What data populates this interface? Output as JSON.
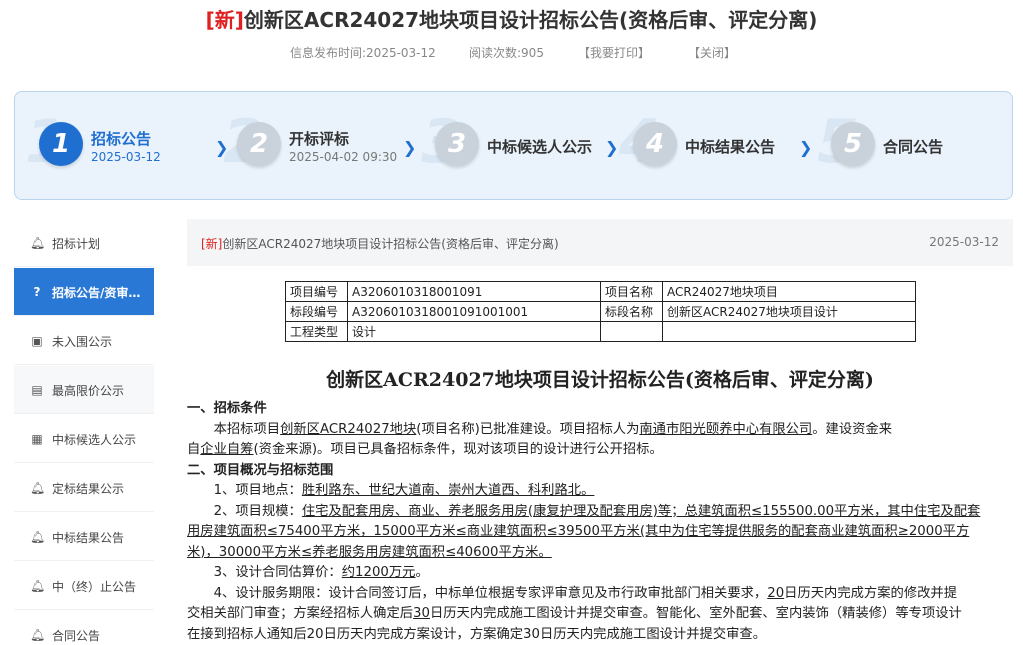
{
  "header": {
    "new_tag": "[新]",
    "title": "创新区ACR24027地块项目设计招标公告(资格后审、评定分离)",
    "publish_time": "信息发布时间:2025-03-12",
    "read_count": "阅读次数:905",
    "print_label": "【我要打印】",
    "close_label": "【关闭】"
  },
  "steps": [
    {
      "num": "1",
      "label": "招标公告",
      "date": "2025-03-12"
    },
    {
      "num": "2",
      "label": "开标评标",
      "date": "2025-04-02 09:30"
    },
    {
      "num": "3",
      "label": "中标候选人公示",
      "date": ""
    },
    {
      "num": "4",
      "label": "中标结果公告",
      "date": ""
    },
    {
      "num": "5",
      "label": "合同公告",
      "date": ""
    }
  ],
  "sidebar": {
    "items": [
      {
        "label": "招标计划",
        "icon": "bell-icon"
      },
      {
        "label": "招标公告/资审…",
        "icon": "question-icon"
      },
      {
        "label": "未入围公示",
        "icon": "briefcase-icon"
      },
      {
        "label": "最高限价公示",
        "icon": "price-tag-icon"
      },
      {
        "label": "中标候选人公示",
        "icon": "document-icon"
      },
      {
        "label": "定标结果公示",
        "icon": "bell-icon"
      },
      {
        "label": "中标结果公告",
        "icon": "bell-icon"
      },
      {
        "label": "中（终）止公告",
        "icon": "bell-icon"
      },
      {
        "label": "合同公告",
        "icon": "bell-icon"
      }
    ]
  },
  "crumb": {
    "new_tag": "[新]",
    "title": "创新区ACR24027地块项目设计招标公告(资格后审、评定分离)",
    "date": "2025-03-12"
  },
  "info_table": {
    "r1": [
      "项目编号",
      "A3206010318001091",
      "项目名称",
      "ACR24027地块项目"
    ],
    "r2": [
      "标段编号",
      "A3206010318001091001001",
      "标段名称",
      "创新区ACR24027地块项目设计"
    ],
    "r3": [
      "工程类型",
      "设计",
      "",
      ""
    ]
  },
  "doc": {
    "title": "创新区ACR24027地块项目设计招标公告(资格后审、评定分离)",
    "s1_heading": "一、招标条件",
    "s1_a": "本招标项目",
    "s1_b": "创新区ACR24027地块",
    "s1_c": "(项目名称)已批准建设。项目招标人为",
    "s1_d": "南通市阳光颐养中心有限公司",
    "s1_e": "。建设资金来",
    "s1_f": "自",
    "s1_g": "企业自筹",
    "s1_h": "(资金来源)。项目已具备招标条件，现对该项目的设计进行公开招标。",
    "s2_heading": "二、项目概况与招标范围",
    "p1_a": "1、项目地点：",
    "p1_b": "胜利路东、世纪大道南、崇州大道西、科利路北。",
    "p2_a": "2、项目规模：",
    "p2_b": "住宅及配套用房、商业、养老服务用房(康复护理及配套用房)等；总建筑面积≤155500.00平方米，其中住宅及配套",
    "p2_c": "用房建筑面积≤75400平方米，15000平方米≤商业建筑面积≤39500平方米(其中为住宅等提供服务的配套商业建筑面积≥2000平方",
    "p2_d": "米)，30000平方米≤养老服务用房建筑面积≤40600平方米。",
    "p3_a": "3、设计合同估算价：",
    "p3_b": "约1200万元",
    "p3_c": "。",
    "p4_a": "4、设计服务期限：设计合同签订后，中标单位根据专家评审意见及市行政审批部门相关要求，",
    "p4_b": "20",
    "p4_c": "日历天内完成方案的修改并提",
    "p4_d": "交相关部门审查；方案经招标人确定后",
    "p4_e": "30",
    "p4_f": "日历天内完成施工图设计并提交审查。智能化、室外配套、室内装饰（精装修）等专项设计",
    "p4_g": "在接到招标人通知后20日历天内完成方案设计，方案确定30日历天内完成施工图设计并提交审查。"
  }
}
